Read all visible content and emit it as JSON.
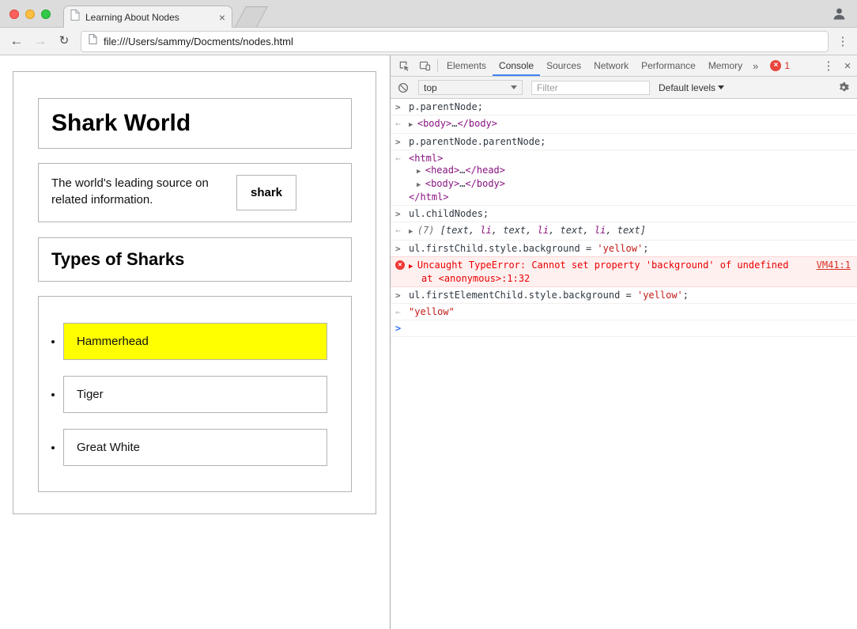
{
  "icons": {
    "back": "←",
    "forward": "→",
    "reload": "↻",
    "overflow_menu": "⋮",
    "tab_close": "×",
    "more_tabs": "»",
    "devtools_menu": "⋮",
    "devtools_close": "×",
    "error_badge": "×"
  },
  "browser": {
    "tab_title": "Learning About Nodes",
    "url": "file:///Users/sammy/Docments/nodes.html"
  },
  "page": {
    "heading1": "Shark World",
    "paragraph": "The world's leading source on related information.",
    "strong_label": "shark",
    "heading2": "Types of Sharks",
    "list_items": [
      {
        "label": "Hammerhead",
        "highlighted": true
      },
      {
        "label": "Tiger",
        "highlighted": false
      },
      {
        "label": "Great White",
        "highlighted": false
      }
    ],
    "highlight_color": "#ffff00"
  },
  "devtools": {
    "tabs": [
      "Elements",
      "Console",
      "Sources",
      "Network",
      "Performance",
      "Memory"
    ],
    "active_tab": "Console",
    "error_count": "1",
    "accent_color": "#4285f4",
    "console_toolbar": {
      "context_selector": "top",
      "filter_placeholder": "Filter",
      "levels_label": "Default levels"
    },
    "console": {
      "lines": [
        {
          "kind": "input",
          "marker": ">",
          "mcls": "m-in",
          "rows": [
            {
              "parts": [
                {
                  "t": "p.parentNode;",
                  "cls": "plain"
                }
              ]
            }
          ]
        },
        {
          "kind": "result",
          "marker": "←",
          "mcls": "m-out",
          "rows": [
            {
              "parts": [
                {
                  "t": "▶ ",
                  "cls": "tri"
                },
                {
                  "t": "<body>",
                  "cls": "tag"
                },
                {
                  "t": "…",
                  "cls": "plain"
                },
                {
                  "t": "</body>",
                  "cls": "tag"
                }
              ]
            }
          ]
        },
        {
          "kind": "input",
          "marker": ">",
          "mcls": "m-in",
          "rows": [
            {
              "parts": [
                {
                  "t": "p.parentNode.parentNode;",
                  "cls": "plain"
                }
              ]
            }
          ]
        },
        {
          "kind": "result",
          "marker": "←",
          "mcls": "m-out",
          "rows": [
            {
              "parts": [
                {
                  "t": "<html>",
                  "cls": "tag"
                }
              ]
            },
            {
              "indent": 1,
              "parts": [
                {
                  "t": "▶ ",
                  "cls": "tri"
                },
                {
                  "t": "<head>",
                  "cls": "tag"
                },
                {
                  "t": "…",
                  "cls": "plain"
                },
                {
                  "t": "</head>",
                  "cls": "tag"
                }
              ]
            },
            {
              "indent": 1,
              "parts": [
                {
                  "t": "▶ ",
                  "cls": "tri"
                },
                {
                  "t": "<body>",
                  "cls": "tag"
                },
                {
                  "t": "…",
                  "cls": "plain"
                },
                {
                  "t": "</body>",
                  "cls": "tag"
                }
              ]
            },
            {
              "parts": [
                {
                  "t": "</html>",
                  "cls": "tag"
                }
              ]
            }
          ]
        },
        {
          "kind": "input",
          "marker": ">",
          "mcls": "m-in",
          "rows": [
            {
              "parts": [
                {
                  "t": "ul.childNodes;",
                  "cls": "plain"
                }
              ]
            }
          ]
        },
        {
          "kind": "result",
          "marker": "←",
          "mcls": "m-out",
          "rows": [
            {
              "parts": [
                {
                  "t": "▶ ",
                  "cls": "tri"
                },
                {
                  "t": "(7) ",
                  "cls": "meta"
                },
                {
                  "t": "[",
                  "cls": "arr"
                },
                {
                  "t": "text",
                  "cls": "ntext"
                },
                {
                  "t": ", ",
                  "cls": "arr"
                },
                {
                  "t": "li",
                  "cls": "nel"
                },
                {
                  "t": ", ",
                  "cls": "arr"
                },
                {
                  "t": "text",
                  "cls": "ntext"
                },
                {
                  "t": ", ",
                  "cls": "arr"
                },
                {
                  "t": "li",
                  "cls": "nel"
                },
                {
                  "t": ", ",
                  "cls": "arr"
                },
                {
                  "t": "text",
                  "cls": "ntext"
                },
                {
                  "t": ", ",
                  "cls": "arr"
                },
                {
                  "t": "li",
                  "cls": "nel"
                },
                {
                  "t": ", ",
                  "cls": "arr"
                },
                {
                  "t": "text",
                  "cls": "ntext"
                },
                {
                  "t": "]",
                  "cls": "arr"
                }
              ]
            }
          ]
        },
        {
          "kind": "input",
          "marker": ">",
          "mcls": "m-in",
          "rows": [
            {
              "parts": [
                {
                  "t": "ul.firstChild.style.background = ",
                  "cls": "plain"
                },
                {
                  "t": "'yellow'",
                  "cls": "str"
                },
                {
                  "t": ";",
                  "cls": "plain"
                }
              ]
            }
          ]
        },
        {
          "kind": "error",
          "marker": "×",
          "mcls": "m-err",
          "link": "VM41:1",
          "rows": [
            {
              "parts": [
                {
                  "t": "▶ ",
                  "cls": "tri-err"
                },
                {
                  "t": "Uncaught TypeError: Cannot set property 'background' of undefined",
                  "cls": "errtext"
                }
              ]
            },
            {
              "indent": 2,
              "parts": [
                {
                  "t": "at <anonymous>:1:32",
                  "cls": "errtext"
                }
              ]
            }
          ]
        },
        {
          "kind": "input",
          "marker": ">",
          "mcls": "m-in",
          "rows": [
            {
              "parts": [
                {
                  "t": "ul.firstElementChild.style.background = ",
                  "cls": "plain"
                },
                {
                  "t": "'yellow'",
                  "cls": "str"
                },
                {
                  "t": ";",
                  "cls": "plain"
                }
              ]
            }
          ]
        },
        {
          "kind": "result",
          "marker": "←",
          "mcls": "m-out",
          "rows": [
            {
              "parts": [
                {
                  "t": "\"yellow\"",
                  "cls": "str"
                }
              ]
            }
          ]
        },
        {
          "kind": "prompt",
          "marker": ">",
          "mcls": "m-prompt",
          "rows": [
            {
              "parts": []
            }
          ]
        }
      ]
    }
  }
}
